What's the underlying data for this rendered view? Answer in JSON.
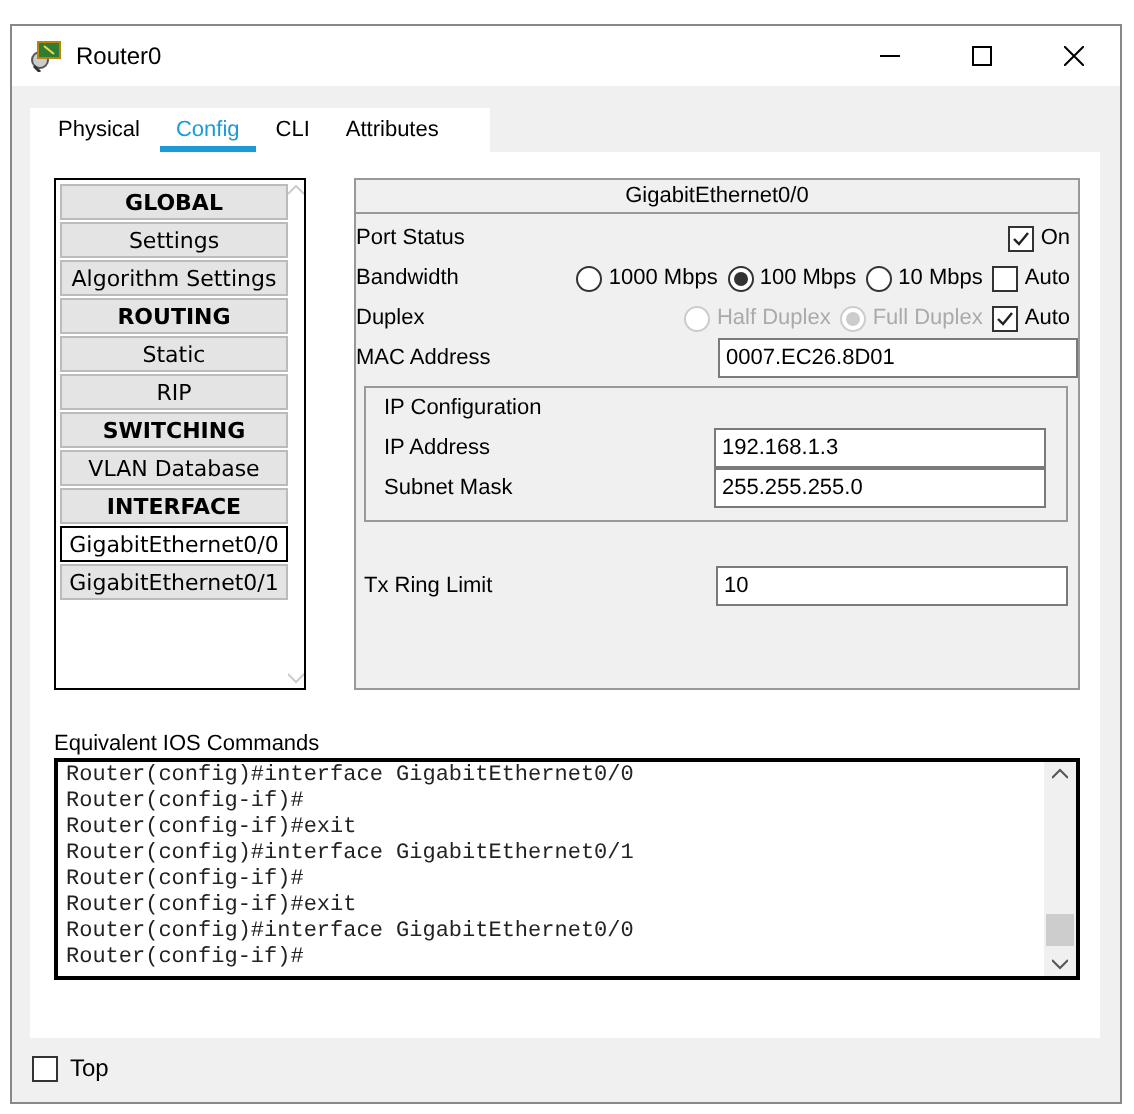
{
  "window": {
    "title": "Router0"
  },
  "tabs": [
    {
      "label": "Physical",
      "selected": false
    },
    {
      "label": "Config",
      "selected": true
    },
    {
      "label": "CLI",
      "selected": false
    },
    {
      "label": "Attributes",
      "selected": false
    }
  ],
  "sidebar": {
    "items": [
      {
        "label": "GLOBAL",
        "kind": "header",
        "selected": false
      },
      {
        "label": "Settings",
        "kind": "item",
        "selected": false
      },
      {
        "label": "Algorithm Settings",
        "kind": "item",
        "selected": false
      },
      {
        "label": "ROUTING",
        "kind": "header",
        "selected": false
      },
      {
        "label": "Static",
        "kind": "item",
        "selected": false
      },
      {
        "label": "RIP",
        "kind": "item",
        "selected": false
      },
      {
        "label": "SWITCHING",
        "kind": "header",
        "selected": false
      },
      {
        "label": "VLAN Database",
        "kind": "item",
        "selected": false
      },
      {
        "label": "INTERFACE",
        "kind": "header",
        "selected": false
      },
      {
        "label": "GigabitEthernet0/0",
        "kind": "item",
        "selected": true
      },
      {
        "label": "GigabitEthernet0/1",
        "kind": "item",
        "selected": false
      }
    ]
  },
  "interface": {
    "title": "GigabitEthernet0/0",
    "port_status": {
      "label": "Port Status",
      "toggle_label": "On",
      "on": true
    },
    "bandwidth": {
      "label": "Bandwidth",
      "disabled": false,
      "options": [
        {
          "label": "1000 Mbps",
          "selected": false
        },
        {
          "label": "100 Mbps",
          "selected": true
        },
        {
          "label": "10 Mbps",
          "selected": false
        }
      ],
      "auto": {
        "label": "Auto",
        "checked": false
      }
    },
    "duplex": {
      "label": "Duplex",
      "disabled": true,
      "options": [
        {
          "label": "Half Duplex",
          "selected": false
        },
        {
          "label": "Full Duplex",
          "selected": true
        }
      ],
      "auto": {
        "label": "Auto",
        "checked": true
      }
    },
    "mac": {
      "label": "MAC Address",
      "value": "0007.EC26.8D01"
    },
    "ip_config": {
      "title": "IP Configuration",
      "ip": {
        "label": "IP Address",
        "value": "192.168.1.3"
      },
      "mask": {
        "label": "Subnet Mask",
        "value": "255.255.255.0"
      }
    },
    "tx_ring": {
      "label": "Tx Ring Limit",
      "value": "10"
    }
  },
  "ios": {
    "label": "Equivalent IOS Commands",
    "lines": [
      "Router(config)#interface GigabitEthernet0/0",
      "Router(config-if)#",
      "Router(config-if)#exit",
      "Router(config)#interface GigabitEthernet0/1",
      "Router(config-if)#",
      "Router(config-if)#exit",
      "Router(config)#interface GigabitEthernet0/0",
      "Router(config-if)#"
    ]
  },
  "top": {
    "label": "Top",
    "checked": false
  }
}
